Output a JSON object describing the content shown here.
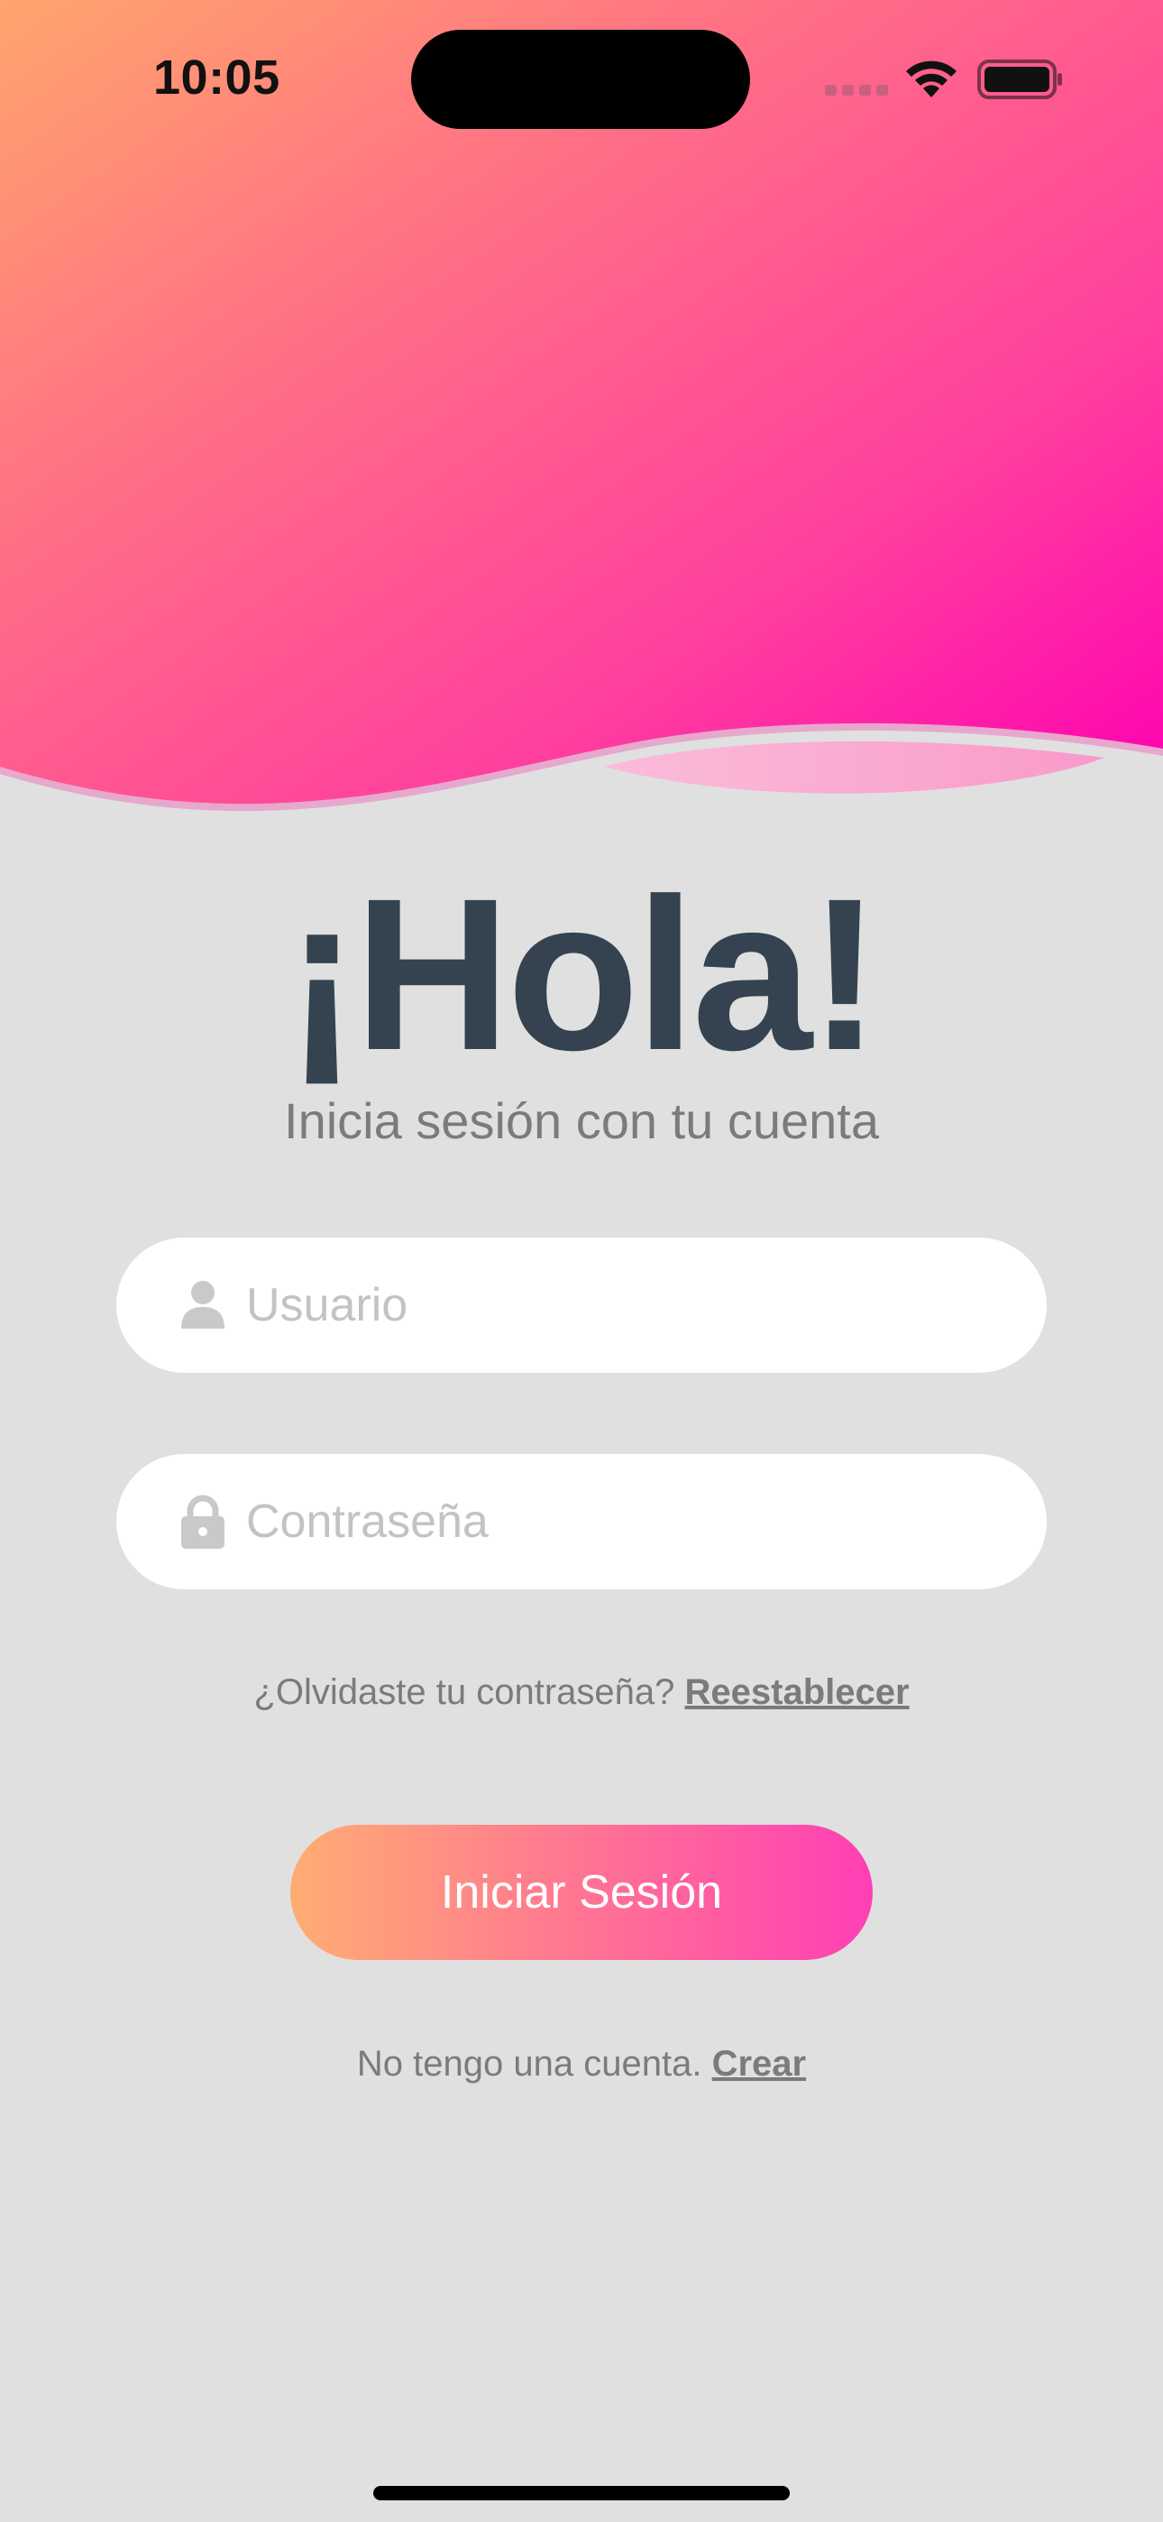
{
  "status_bar": {
    "time": "10:05"
  },
  "header": {
    "title": "¡Hola!",
    "subtitle": "Inicia sesión con tu cuenta"
  },
  "form": {
    "username_placeholder": "Usuario",
    "password_placeholder": "Contraseña",
    "forgot_text": "¿Olvidaste tu contraseña?",
    "forgot_link": "Reestablecer",
    "login_label": "Iniciar Sesión",
    "create_text": "No tengo una cuenta.",
    "create_link": "Crear"
  },
  "icons": {
    "username": "person-icon",
    "password": "lock-icon",
    "wifi": "wifi-icon",
    "battery": "battery-icon",
    "signal": "cellular-signal-icon"
  },
  "colors": {
    "gradient_start": "#ffa86b",
    "gradient_mid": "#ff5f8f",
    "gradient_end": "#ff00b0",
    "title": "#34434f",
    "background": "#e0e0e0"
  }
}
